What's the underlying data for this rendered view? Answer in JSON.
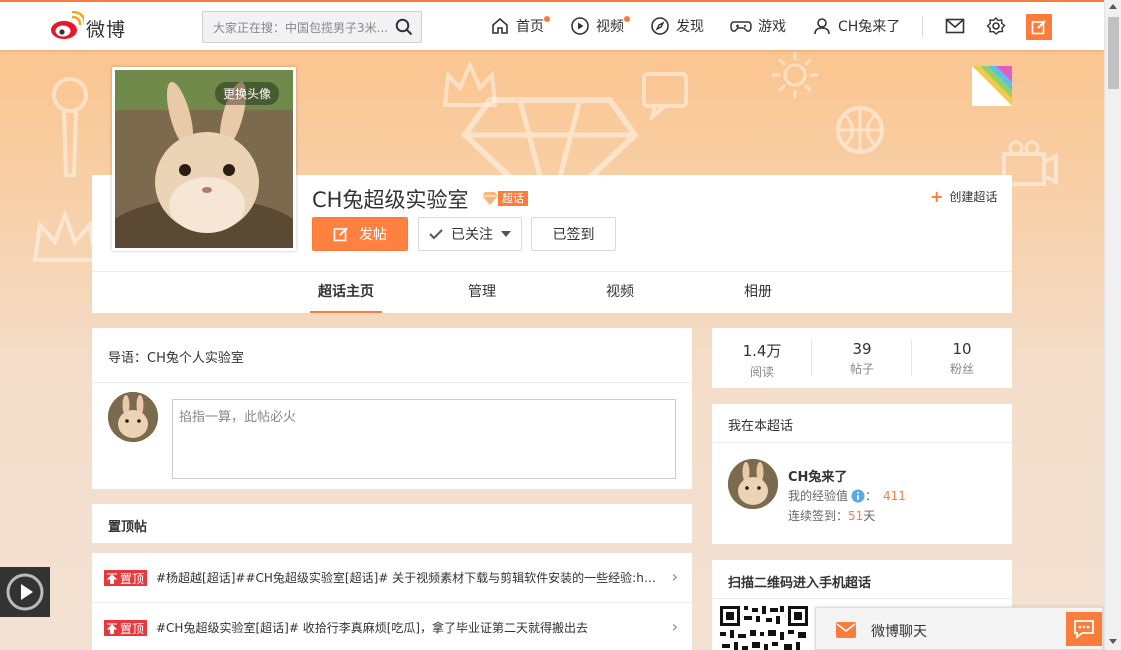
{
  "header": {
    "logo_text": "微博",
    "search_placeholder": "大家正在搜：中国包揽男子3米...",
    "nav": {
      "home": "首页",
      "video": "视频",
      "discover": "发现",
      "game": "游戏",
      "user": "CH兔来了"
    }
  },
  "topic": {
    "change_avatar": "更换头像",
    "name": "CH兔超级实验室",
    "badge": "超话",
    "create_label": "创建超话",
    "buttons": {
      "post": "发帖",
      "follow": "已关注",
      "signed": "已签到"
    },
    "tabs": [
      "超话主页",
      "管理",
      "视频",
      "相册"
    ]
  },
  "intro": {
    "label": "导语：",
    "text": "CH兔个人实验室",
    "composer_placeholder": "掐指一算，此帖必火"
  },
  "pinned": {
    "title": "置顶帖",
    "tag": "置顶",
    "items": [
      "#杨超越[超话]##CH兔超级实验室[超话]# 关于视频素材下载与剪辑软件安装的一些经验:ht...",
      "#CH兔超级实验室[超话]# 收拾行李真麻烦[吃瓜]，拿了毕业证第二天就得搬出去"
    ]
  },
  "stats": [
    {
      "num": "1.4万",
      "label": "阅读"
    },
    {
      "num": "39",
      "label": "帖子"
    },
    {
      "num": "10",
      "label": "粉丝"
    }
  ],
  "me": {
    "title": "我在本超话",
    "name": "CH兔来了",
    "exp_label": "我的经验值",
    "exp_value": "411",
    "sign_label": "连续签到：",
    "sign_days": "51",
    "sign_unit": "天"
  },
  "qr": {
    "title": "扫描二维码进入手机超话"
  },
  "chat": {
    "label": "微博聊天"
  },
  "colors": {
    "accent": "#fa7d3c",
    "pin_red": "#e8383d"
  }
}
